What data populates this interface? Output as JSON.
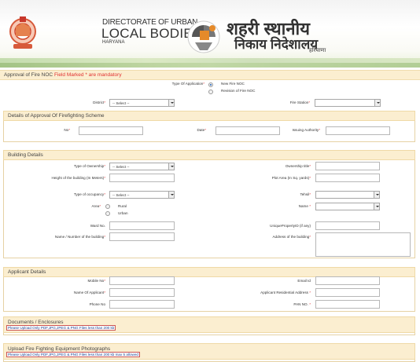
{
  "header": {
    "directorate_line1": "DIRECTORATE OF URBAN",
    "directorate_line2": "LOCAL BODIES",
    "directorate_line3": "HARYANA",
    "hindi_line1": "शहरी स्थानीय",
    "hindi_line2": "निकाय निदेशालय",
    "hindi_line3": "हरियाणा",
    "emblem_icon": "haryana-emblem-icon",
    "logo_icon": "ulb-logo-icon"
  },
  "page": {
    "title": "Approval of Fire NOC",
    "mandatory_note": "Field Marked * are mandatory"
  },
  "application": {
    "type_label": "Type Of Application",
    "options": [
      "New Fire NOC",
      "Revision of Fire NOC"
    ],
    "selected": "New Fire NOC",
    "district_label": "District",
    "district_value": "-- Select --",
    "fire_station_label": "Fire Station"
  },
  "scheme": {
    "heading": "Details of Approval Of Firefighting Scheme",
    "no_label": "No",
    "date_label": "Date",
    "authority_label": "Issuing Authority"
  },
  "building": {
    "heading": "Building Details",
    "ownership_type_label": "Type of Ownership",
    "ownership_type_value": "-- Select --",
    "ownership_title_label": "Ownership title",
    "height_label": "Height of the building (In Meters)",
    "plot_area_label": "Plot Area (In Sq. yards)",
    "occupancy_label": "Type of occupancy",
    "occupancy_value": "-- Select --",
    "tehsil_label": "Tehsil",
    "area_label": "Area",
    "area_options": [
      "Rural",
      "Urban"
    ],
    "name_label": "Name",
    "ward_label": "Ward No.",
    "unique_id_label": "UniquePropertyID (if any)",
    "building_name_label": "Name / Number of the building",
    "address_label": "Address of the building"
  },
  "applicant": {
    "heading": "Applicant Details",
    "mobile_label": "Mobile No",
    "email_label": "Email Id",
    "name_label": "Name Of Applicant",
    "res_address_label": "Applicant Residential Address",
    "phone_label": "Phone No",
    "pan_label": "PAN NO."
  },
  "documents": {
    "heading": "Documents / Enclosures",
    "note": "Please Upload Only PDF,JPG,JPEG & PNG Files less than 200 kb"
  },
  "photos": {
    "heading": "Upload Fire Fighting Equipment Photographs",
    "note": "Please Upload Only PDF,JPG,JPEG & PNG Files less than 200 kb max 5 allowed"
  },
  "colors": {
    "section_bg": "#fbeed0",
    "section_border": "#e6d2a4",
    "mandatory_red": "#e03030",
    "note_blue": "#1c3f8f"
  }
}
